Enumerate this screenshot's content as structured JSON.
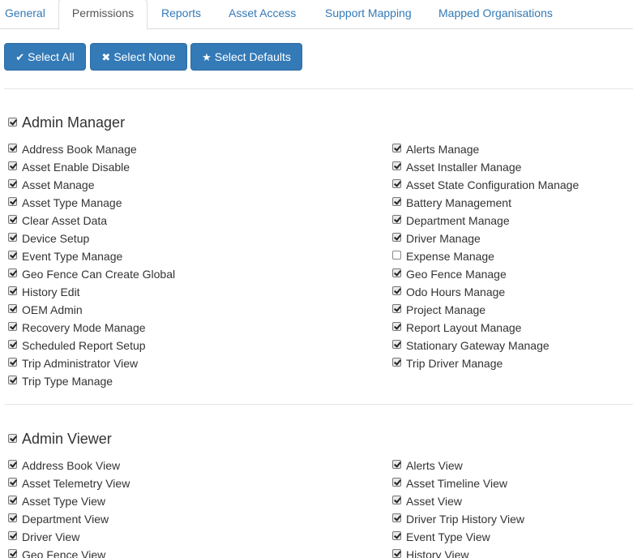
{
  "tabs": [
    {
      "label": "General",
      "active": false
    },
    {
      "label": "Permissions",
      "active": true
    },
    {
      "label": "Reports",
      "active": false
    },
    {
      "label": "Asset Access",
      "active": false
    },
    {
      "label": "Support Mapping",
      "active": false
    },
    {
      "label": "Mapped Organisations",
      "active": false
    }
  ],
  "toolbar": {
    "select_all": {
      "label": "Select All",
      "icon": "check-icon"
    },
    "select_none": {
      "label": "Select None",
      "icon": "times-icon"
    },
    "select_defaults": {
      "label": "Select Defaults",
      "icon": "star-icon"
    },
    "button_color": "#337ab7"
  },
  "groups": [
    {
      "title": "Admin Manager",
      "checked": true,
      "left_items": [
        {
          "label": "Address Book Manage",
          "checked": true
        },
        {
          "label": "Asset Enable Disable",
          "checked": true
        },
        {
          "label": "Asset Manage",
          "checked": true
        },
        {
          "label": "Asset Type Manage",
          "checked": true
        },
        {
          "label": "Clear Asset Data",
          "checked": true
        },
        {
          "label": "Device Setup",
          "checked": true
        },
        {
          "label": "Event Type Manage",
          "checked": true
        },
        {
          "label": "Geo Fence Can Create Global",
          "checked": true
        },
        {
          "label": "History Edit",
          "checked": true
        },
        {
          "label": "OEM Admin",
          "checked": true
        },
        {
          "label": "Recovery Mode Manage",
          "checked": true
        },
        {
          "label": "Scheduled Report Setup",
          "checked": true
        },
        {
          "label": "Trip Administrator View",
          "checked": true
        },
        {
          "label": "Trip Type Manage",
          "checked": true
        }
      ],
      "right_items": [
        {
          "label": "Alerts Manage",
          "checked": true
        },
        {
          "label": "Asset Installer Manage",
          "checked": true
        },
        {
          "label": "Asset State Configuration Manage",
          "checked": true
        },
        {
          "label": "Battery Management",
          "checked": true
        },
        {
          "label": "Department Manage",
          "checked": true
        },
        {
          "label": "Driver Manage",
          "checked": true
        },
        {
          "label": "Expense Manage",
          "checked": false
        },
        {
          "label": "Geo Fence Manage",
          "checked": true
        },
        {
          "label": "Odo Hours Manage",
          "checked": true
        },
        {
          "label": "Project Manage",
          "checked": true
        },
        {
          "label": "Report Layout Manage",
          "checked": true
        },
        {
          "label": "Stationary Gateway Manage",
          "checked": true
        },
        {
          "label": "Trip Driver Manage",
          "checked": true
        }
      ]
    },
    {
      "title": "Admin Viewer",
      "checked": true,
      "left_items": [
        {
          "label": "Address Book View",
          "checked": true
        },
        {
          "label": "Asset Telemetry View",
          "checked": true
        },
        {
          "label": "Asset Type View",
          "checked": true
        },
        {
          "label": "Department View",
          "checked": true
        },
        {
          "label": "Driver View",
          "checked": true
        },
        {
          "label": "Geo Fence View",
          "checked": true
        }
      ],
      "right_items": [
        {
          "label": "Alerts View",
          "checked": true
        },
        {
          "label": "Asset Timeline View",
          "checked": true
        },
        {
          "label": "Asset View",
          "checked": true
        },
        {
          "label": "Driver Trip History View",
          "checked": true
        },
        {
          "label": "Event Type View",
          "checked": true
        },
        {
          "label": "History View",
          "checked": true
        }
      ]
    }
  ]
}
